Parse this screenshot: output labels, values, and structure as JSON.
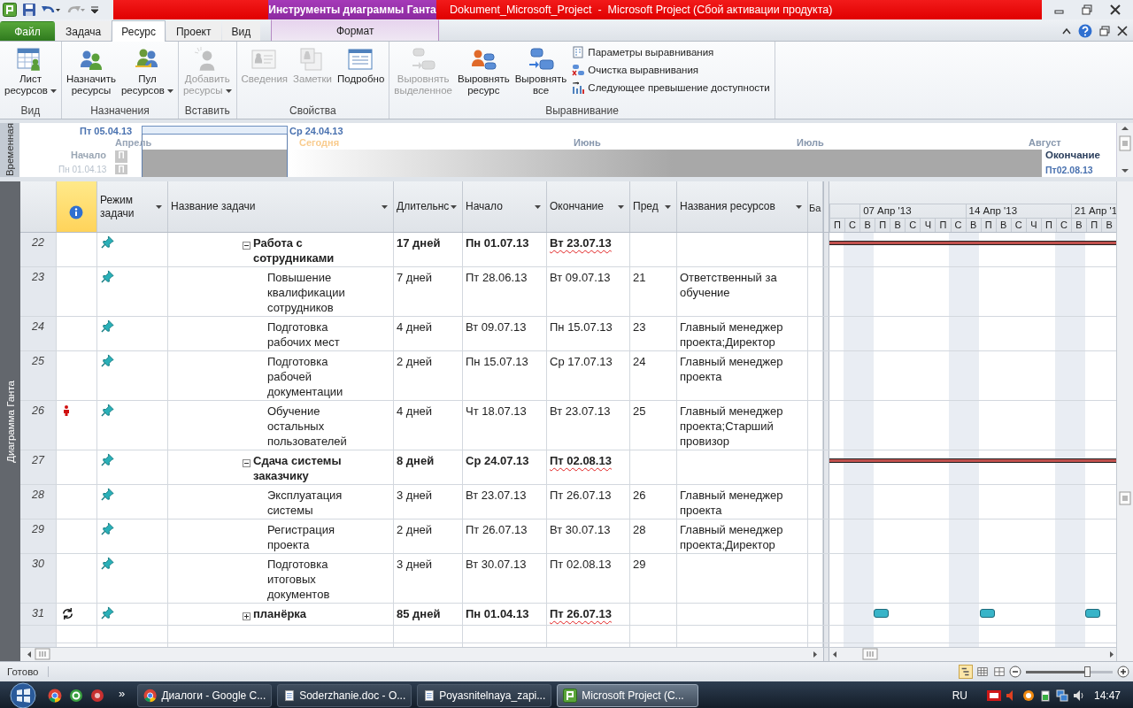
{
  "title_bar": {
    "context_label": "Инструменты диаграммы Ганта",
    "title": "Dokument_Microsoft_Project  -  Microsoft Project (Сбой активации продукта)"
  },
  "ribbon_tabs": [
    {
      "label": "Файл",
      "kind": "file",
      "selected": false
    },
    {
      "label": "Задача",
      "kind": "tab",
      "selected": false
    },
    {
      "label": "Ресурс",
      "kind": "tab",
      "selected": true
    },
    {
      "label": "Проект",
      "kind": "tab",
      "selected": false
    },
    {
      "label": "Вид",
      "kind": "tab",
      "selected": false
    },
    {
      "label": "Формат",
      "kind": "context",
      "selected": false
    }
  ],
  "ribbon_groups": [
    {
      "label": "Вид",
      "buttons": [
        {
          "label": "Лист\nресурсов",
          "kind": "large",
          "dropdown": true,
          "disabled": false
        }
      ]
    },
    {
      "label": "Назначения",
      "buttons": [
        {
          "label": "Назначить\nресурсы",
          "kind": "large",
          "dropdown": false,
          "disabled": false
        },
        {
          "label": "Пул\nресурсов",
          "kind": "large",
          "dropdown": true,
          "disabled": false
        }
      ]
    },
    {
      "label": "Вставить",
      "buttons": [
        {
          "label": "Добавить\nресурсы",
          "kind": "large",
          "dropdown": true,
          "disabled": true
        }
      ]
    },
    {
      "label": "Свойства",
      "buttons": [
        {
          "label": "Сведения",
          "kind": "large",
          "dropdown": false,
          "disabled": true
        },
        {
          "label": "Заметки",
          "kind": "large",
          "dropdown": false,
          "disabled": true
        },
        {
          "label": "Подробно",
          "kind": "large",
          "dropdown": false,
          "disabled": false
        }
      ]
    },
    {
      "label": "Выравнивание",
      "buttons": [
        {
          "label": "Выровнять\nвыделенное",
          "kind": "large",
          "dropdown": false,
          "disabled": true
        },
        {
          "label": "Выровнять\nресурс",
          "kind": "large",
          "dropdown": false,
          "disabled": false
        },
        {
          "label": "Выровнять\nвсе",
          "kind": "large",
          "dropdown": false,
          "disabled": false
        },
        {
          "label": "Параметры выравнивания",
          "kind": "small",
          "disabled": false
        },
        {
          "label": "Очистка выравнивания",
          "kind": "small",
          "disabled": false
        },
        {
          "label": "Следующее превышение доступности",
          "kind": "small",
          "disabled": false
        }
      ]
    }
  ],
  "timeline": {
    "label": "Временная",
    "range_start": "Пт 05.04.13",
    "range_end": "Ср 24.04.13",
    "months": [
      "Апрель",
      "Июнь",
      "Июль",
      "Август"
    ],
    "today": "Сегодня",
    "start_label": "Начало",
    "start_date": "Пн 01.04.13",
    "finish_label": "Окончание",
    "finish_date": "Пт02.08.13",
    "marks": [
      "П",
      "П"
    ]
  },
  "view_label": "Диаграмма Ганта",
  "table": {
    "columns": [
      {
        "kind": "info",
        "selected": true
      },
      {
        "label": "Режим задачи",
        "kind": "text",
        "selected": false
      },
      {
        "label": "Название задачи",
        "kind": "text",
        "selected": false
      },
      {
        "label": "Длительнс",
        "kind": "text",
        "selected": false
      },
      {
        "label": "Начало",
        "kind": "text",
        "selected": false
      },
      {
        "label": "Окончание",
        "kind": "text",
        "selected": false
      },
      {
        "label": "Пред",
        "kind": "text",
        "selected": false
      },
      {
        "label": "Названия ресурсов",
        "kind": "text",
        "selected": false
      },
      {
        "label": "Ба",
        "kind": "text",
        "selected": false
      }
    ],
    "rows": [
      {
        "id": "22",
        "kind": "plain",
        "summary": true,
        "expanded": true,
        "name": "Работа с сотрудниками",
        "duration": "17 дней",
        "start": "Пн 01.07.13",
        "finish": "Вт 23.07.13",
        "children": [
          {
            "id": "23",
            "kind": "plain",
            "summary": false,
            "name": "Повышение квалификации сотрудников",
            "duration": "7 дней",
            "start": "Пт 28.06.13",
            "finish": "Вт 09.07.13",
            "predecessors": "21",
            "resources": "Ответственный за обучение"
          },
          {
            "id": "24",
            "kind": "plain",
            "summary": false,
            "name": "Подготовка рабочих мест",
            "duration": "4 дней",
            "start": "Вт 09.07.13",
            "finish": "Пн 15.07.13",
            "predecessors": "23",
            "resources": "Главный менеджер проекта;Директор"
          },
          {
            "id": "25",
            "kind": "plain",
            "summary": false,
            "name": "Подготовка рабочей документации",
            "duration": "2 дней",
            "start": "Пн 15.07.13",
            "finish": "Ср 17.07.13",
            "predecessors": "24",
            "resources": "Главный менеджер проекта"
          },
          {
            "id": "26",
            "kind": "person",
            "summary": false,
            "name": "Обучение остальных пользователей",
            "duration": "4 дней",
            "start": "Чт 18.07.13",
            "finish": "Вт 23.07.13",
            "predecessors": "25",
            "resources": "Главный менеджер проекта;Старший провизор"
          }
        ]
      },
      {
        "id": "27",
        "kind": "plain",
        "summary": true,
        "expanded": true,
        "name": "Сдача системы заказчику",
        "duration": "8 дней",
        "start": "Ср 24.07.13",
        "finish": "Пт 02.08.13",
        "children": [
          {
            "id": "28",
            "kind": "plain",
            "summary": false,
            "name": "Эксплуатация системы",
            "duration": "3 дней",
            "start": "Вт 23.07.13",
            "finish": "Пт 26.07.13",
            "predecessors": "26",
            "resources": "Главный менеджер проекта"
          },
          {
            "id": "29",
            "kind": "plain",
            "summary": false,
            "name": "Регистрация проекта",
            "duration": "2 дней",
            "start": "Пт 26.07.13",
            "finish": "Вт 30.07.13",
            "predecessors": "28",
            "resources": "Главный менеджер проекта;Директор"
          },
          {
            "id": "30",
            "kind": "plain",
            "summary": false,
            "name": "Подготовка итоговых документов",
            "duration": "3 дней",
            "start": "Вт 30.07.13",
            "finish": "Пт 02.08.13",
            "predecessors": "29"
          }
        ]
      },
      {
        "id": "31",
        "kind": "recurring",
        "summary": true,
        "expanded": false,
        "name": "планёрка",
        "duration": "85 дней",
        "start": "Пн 01.04.13",
        "finish": "Пт 26.07.13"
      }
    ]
  },
  "gantt": {
    "weeks": [
      "07 Апр '13",
      "14 Апр '13",
      "21 Апр '1"
    ],
    "days": [
      "П",
      "С",
      "В",
      "П",
      "В",
      "С",
      "Ч",
      "П",
      "С",
      "В",
      "П",
      "В",
      "С",
      "Ч",
      "П",
      "С",
      "В",
      "П",
      "В"
    ]
  },
  "status_bar": {
    "text": "Готово",
    "zoom": {
      "level": 0.7
    }
  },
  "taskbar": {
    "tasks": [
      {
        "label": "Диалоги - Google C...",
        "selected": false
      },
      {
        "label": "Soderzhanie.doc - O...",
        "selected": false
      },
      {
        "label": "Poyasnitelnaya_zapi...",
        "selected": false
      },
      {
        "label": "Microsoft Project (C...",
        "selected": true
      }
    ],
    "more": "»",
    "language": "RU",
    "clock": "14:47"
  }
}
